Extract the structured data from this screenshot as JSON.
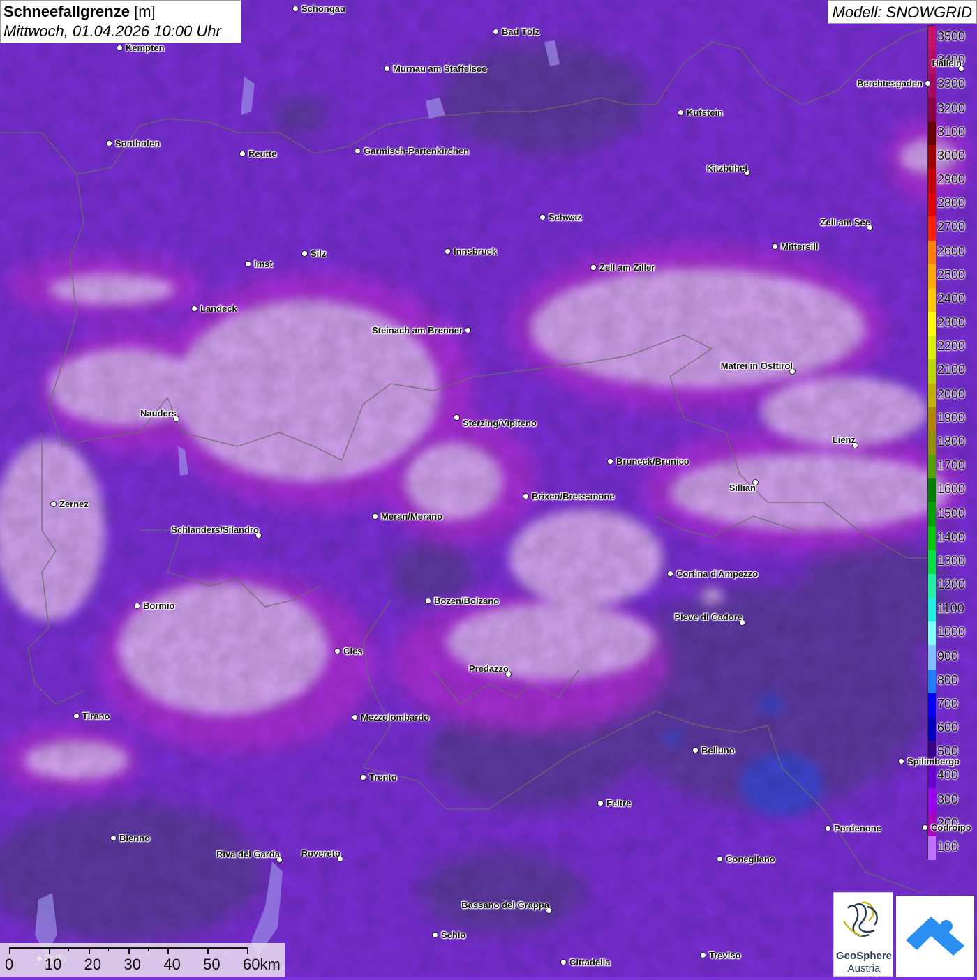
{
  "title": {
    "bold": "Schneefallgrenze",
    "unit": "[m]",
    "subtitle": "Mittwoch, 01.04.2026 10:00 Uhr"
  },
  "model": "Modell: SNOWGRID",
  "legend": {
    "labels": [
      "3500",
      "3400",
      "3300",
      "3200",
      "3100",
      "3000",
      "2900",
      "2800",
      "2700",
      "2600",
      "2500",
      "2400",
      "2300",
      "2200",
      "2100",
      "2000",
      "1900",
      "1800",
      "1700",
      "1600",
      "1500",
      "1400",
      "1300",
      "1200",
      "1100",
      "1000",
      "900",
      "800",
      "700",
      "600",
      "500",
      "400",
      "300",
      "200",
      "100"
    ],
    "colors": [
      "#c8106a",
      "#b80d68",
      "#a50a60",
      "#8a0044",
      "#6a0000",
      "#a00000",
      "#c40000",
      "#e00000",
      "#ff2000",
      "#ff8000",
      "#ffa800",
      "#ffc800",
      "#ffff00",
      "#d8f000",
      "#b8d800",
      "#c0b000",
      "#b08800",
      "#909000",
      "#50a000",
      "#008000",
      "#00a000",
      "#00c800",
      "#00e040",
      "#20f0a0",
      "#20f0e0",
      "#80ffff",
      "#80c0ff",
      "#2080ff",
      "#0000ff",
      "#0000c0",
      "#3a0088",
      "#6600cc",
      "#9c00ee",
      "#aa00bb",
      "#c070ff"
    ]
  },
  "cities": [
    {
      "name": "Schongau"
    },
    {
      "name": "Bad Tölz"
    },
    {
      "name": "Kempten"
    },
    {
      "name": "Murnau am Staffelsee"
    },
    {
      "name": "Hallein"
    },
    {
      "name": "Berchtesgaden"
    },
    {
      "name": "Kufstein"
    },
    {
      "name": "Sonthofen"
    },
    {
      "name": "Reutte"
    },
    {
      "name": "Garmisch-Partenkirchen"
    },
    {
      "name": "Kitzbühel"
    },
    {
      "name": "Schwaz"
    },
    {
      "name": "Zell am See"
    },
    {
      "name": "Innsbruck"
    },
    {
      "name": "Mittersill"
    },
    {
      "name": "Imst"
    },
    {
      "name": "Silz"
    },
    {
      "name": "Zell am Ziller"
    },
    {
      "name": "Landeck"
    },
    {
      "name": "Steinach am Brenner"
    },
    {
      "name": "Matrei in Osttirol"
    },
    {
      "name": "Nauders"
    },
    {
      "name": "Sterzing/Vipiteno"
    },
    {
      "name": "Lienz"
    },
    {
      "name": "Bruneck/Brunico"
    },
    {
      "name": "Sillian"
    },
    {
      "name": "Zernez"
    },
    {
      "name": "Brixen/Bressanone"
    },
    {
      "name": "Meran/Merano"
    },
    {
      "name": "Schlanders/Silandro"
    },
    {
      "name": "Cortina d'Ampezzo"
    },
    {
      "name": "Bozen/Bolzano"
    },
    {
      "name": "Bormio"
    },
    {
      "name": "Pieve di Cadore"
    },
    {
      "name": "Cles"
    },
    {
      "name": "Predazzo"
    },
    {
      "name": "Tirano"
    },
    {
      "name": "Mezzolombardo"
    },
    {
      "name": "Belluno"
    },
    {
      "name": "Spilimbergo"
    },
    {
      "name": "Trento"
    },
    {
      "name": "Feltre"
    },
    {
      "name": "Pordenone"
    },
    {
      "name": "Codroipo"
    },
    {
      "name": "Bienno"
    },
    {
      "name": "Riva del Garda"
    },
    {
      "name": "Rovereto"
    },
    {
      "name": "Conegliano"
    },
    {
      "name": "Bassano del Grappa"
    },
    {
      "name": "Schio"
    },
    {
      "name": "Salò"
    },
    {
      "name": "Cittadella"
    },
    {
      "name": "Treviso"
    }
  ],
  "scale": {
    "labels": [
      "0",
      "10",
      "20",
      "30",
      "40",
      "50",
      "60km"
    ]
  },
  "logos": {
    "geosphere_line1": "GeoSphere",
    "geosphere_line2": "Austria"
  }
}
